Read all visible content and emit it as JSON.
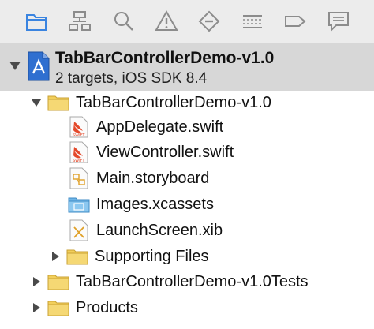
{
  "toolbar": {
    "tabs": [
      {
        "name": "project-navigator-tab",
        "icon": "folder-icon",
        "active": true
      },
      {
        "name": "symbol-navigator-tab",
        "icon": "hierarchy-icon",
        "active": false
      },
      {
        "name": "find-navigator-tab",
        "icon": "search-icon",
        "active": false
      },
      {
        "name": "issue-navigator-tab",
        "icon": "warning-icon",
        "active": false
      },
      {
        "name": "test-navigator-tab",
        "icon": "diamond-minus-icon",
        "active": false
      },
      {
        "name": "debug-navigator-tab",
        "icon": "list-icon",
        "active": false
      },
      {
        "name": "breakpoint-navigator-tab",
        "icon": "breakpoint-tag-icon",
        "active": false
      },
      {
        "name": "report-navigator-tab",
        "icon": "speech-bubble-icon",
        "active": false
      }
    ],
    "accent": "#3a84e0"
  },
  "project": {
    "title": "TabBarControllerDemo-v1.0",
    "subtitle": "2 targets, iOS SDK 8.4",
    "icon": "xcode-project-icon"
  },
  "tree": {
    "root_folder": "TabBarControllerDemo-v1.0",
    "files": {
      "app_delegate": "AppDelegate.swift",
      "view_controller": "ViewController.swift",
      "storyboard": "Main.storyboard",
      "assets": "Images.xcassets",
      "launch_screen": "LaunchScreen.xib",
      "supporting": "Supporting Files"
    },
    "tests_folder": "TabBarControllerDemo-v1.0Tests",
    "products_folder": "Products"
  },
  "colors": {
    "folder": "#f2cf5b",
    "swift": "#e4492b",
    "assets_folder": "#6fb6e8"
  }
}
